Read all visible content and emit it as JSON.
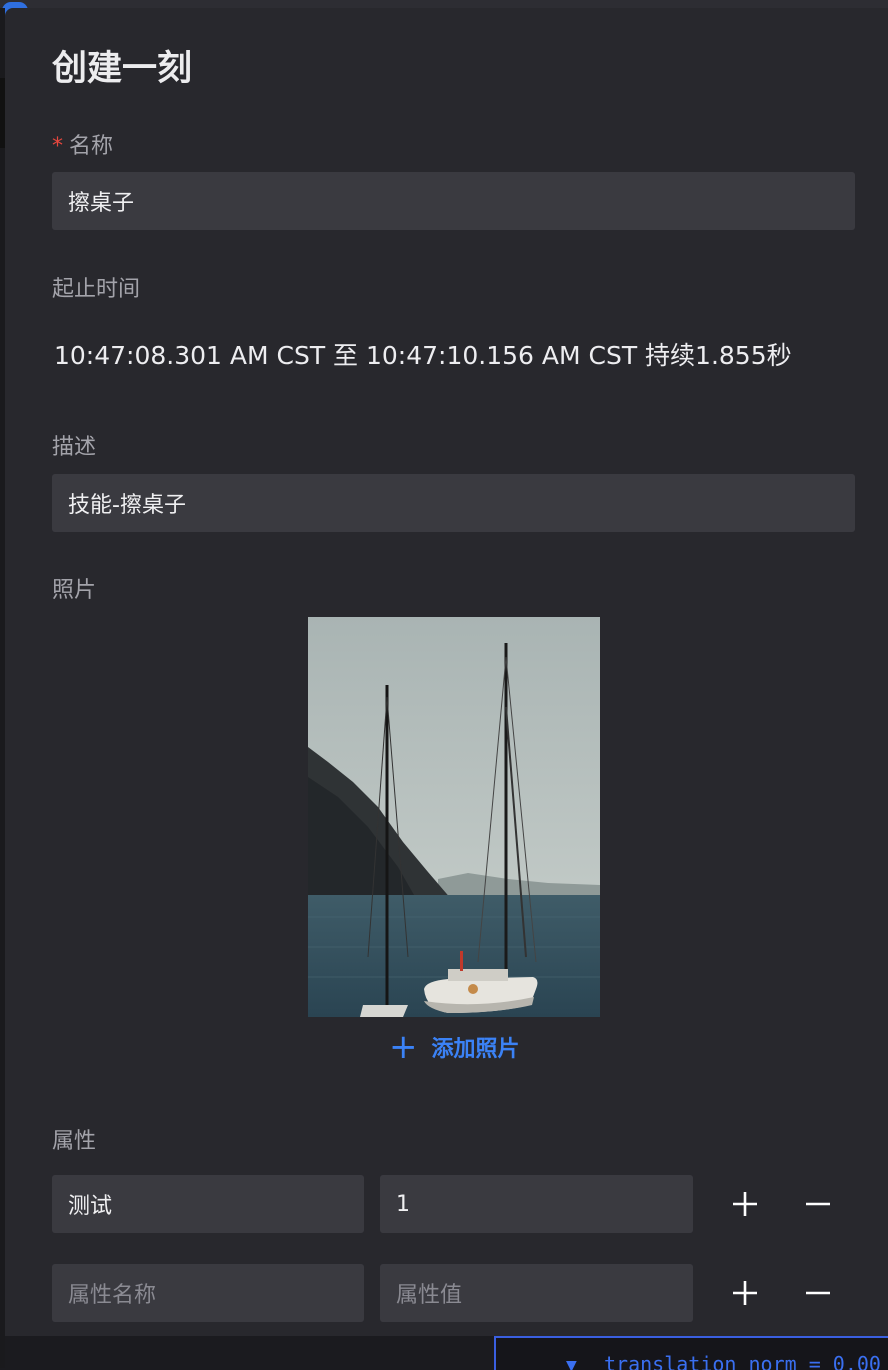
{
  "modal": {
    "title": "创建一刻",
    "name": {
      "label": "名称",
      "required_mark": "*",
      "value": "擦桌子"
    },
    "time_range": {
      "label": "起止时间",
      "text": "10:47:08.301 AM CST 至 10:47:10.156 AM CST 持续1.855秒"
    },
    "description": {
      "label": "描述",
      "value": "技能-擦桌子"
    },
    "photos": {
      "label": "照片",
      "add_label": "添加照片",
      "add_icon": "plus-icon"
    },
    "attributes": {
      "label": "属性",
      "rows": [
        {
          "name": "测试",
          "value": "1"
        },
        {
          "name": "",
          "value": "",
          "name_placeholder": "属性名称",
          "value_placeholder": "属性值"
        }
      ]
    }
  },
  "background": {
    "code_line": "translation_norm = 0.00"
  },
  "colors": {
    "modal_bg": "#28282d",
    "input_bg": "#3a3a40",
    "accent": "#3b82f6",
    "required": "#e8473e"
  }
}
